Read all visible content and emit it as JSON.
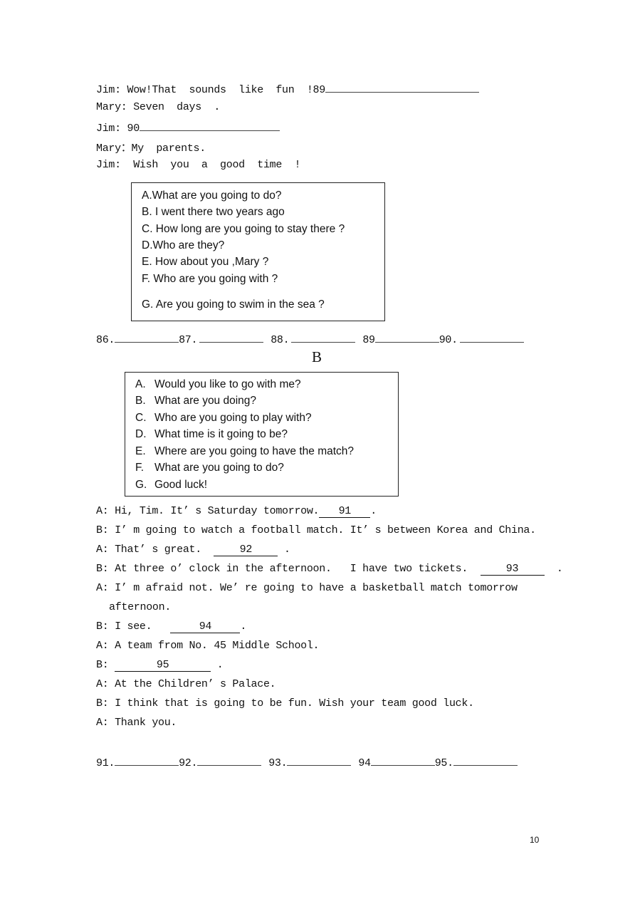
{
  "part_a": {
    "dialogue": [
      {
        "speaker": "Jim:",
        "text": " Wow!That  sounds  like  fun  !89",
        "blank_after": true
      },
      {
        "speaker": "Mary:",
        "text": " Seven  days  .",
        "blank_after": false
      },
      {
        "speaker": "Jim:",
        "text": " 90",
        "blank_after": true
      },
      {
        "speaker": "Mary：",
        "text": "My  parents.",
        "blank_after": false
      },
      {
        "speaker": "Jim:",
        "text": "  Wish  you  a  good  time  !",
        "blank_after": false
      }
    ],
    "options": [
      "A.What are you going to do?",
      "B. I went there two years ago",
      "C. How long are you going to stay there ?",
      "D.Who are they?",
      "E. How about you ,Mary ?",
      "F. Who are you going with ?",
      "G. Are you going to swim in the sea ?"
    ],
    "answer_labels": [
      "86.",
      "87.",
      "88.",
      "89",
      "90."
    ]
  },
  "section_b_heading": "B",
  "part_b": {
    "options": [
      {
        "letter": "A.",
        "text": "Would you like to go with me?"
      },
      {
        "letter": "B.",
        "text": "What are you doing?"
      },
      {
        "letter": "C.",
        "text": "Who are you going to play with?"
      },
      {
        "letter": "D.",
        "text": "What time is it going to be?"
      },
      {
        "letter": "E.",
        "text": "Where are you going to have the match?"
      },
      {
        "letter": "F.",
        "text": "What are you going to do?"
      },
      {
        "letter": "G.",
        "text": "Good luck!"
      }
    ],
    "dialogue": {
      "l1_pre": "A: Hi, Tim. It’ s Saturday tomorrow.",
      "l1_num": "91",
      "l1_post": ".",
      "l2": "B: I’ m going to watch a football match. It’ s between Korea and China.",
      "l3_pre": "A: That’ s great.  ",
      "l3_num": "92",
      "l3_post": " .",
      "l4_pre": "B: At three o’ clock in the afternoon.   I have two tickets.  ",
      "l4_num": "93",
      "l4_post": "  .",
      "l5": "A: I’ m afraid not. We’ re going to have a basketball match tomorrow",
      "l5_cont": "afternoon.",
      "l6_pre": "B: I see.   ",
      "l6_num": "94",
      "l6_post": ".",
      "l7": "A: A team from No. 45 Middle School.",
      "l8_pre": "B: ",
      "l8_num": "95",
      "l8_post": " .",
      "l9": "A: At the Children’ s Palace.",
      "l10": "B: I think that is going to be fun. Wish your team good luck.",
      "l11": "A: Thank you."
    },
    "answer_labels": [
      "91.",
      "92.",
      "93.",
      "94",
      "95."
    ]
  },
  "page_number": "10"
}
